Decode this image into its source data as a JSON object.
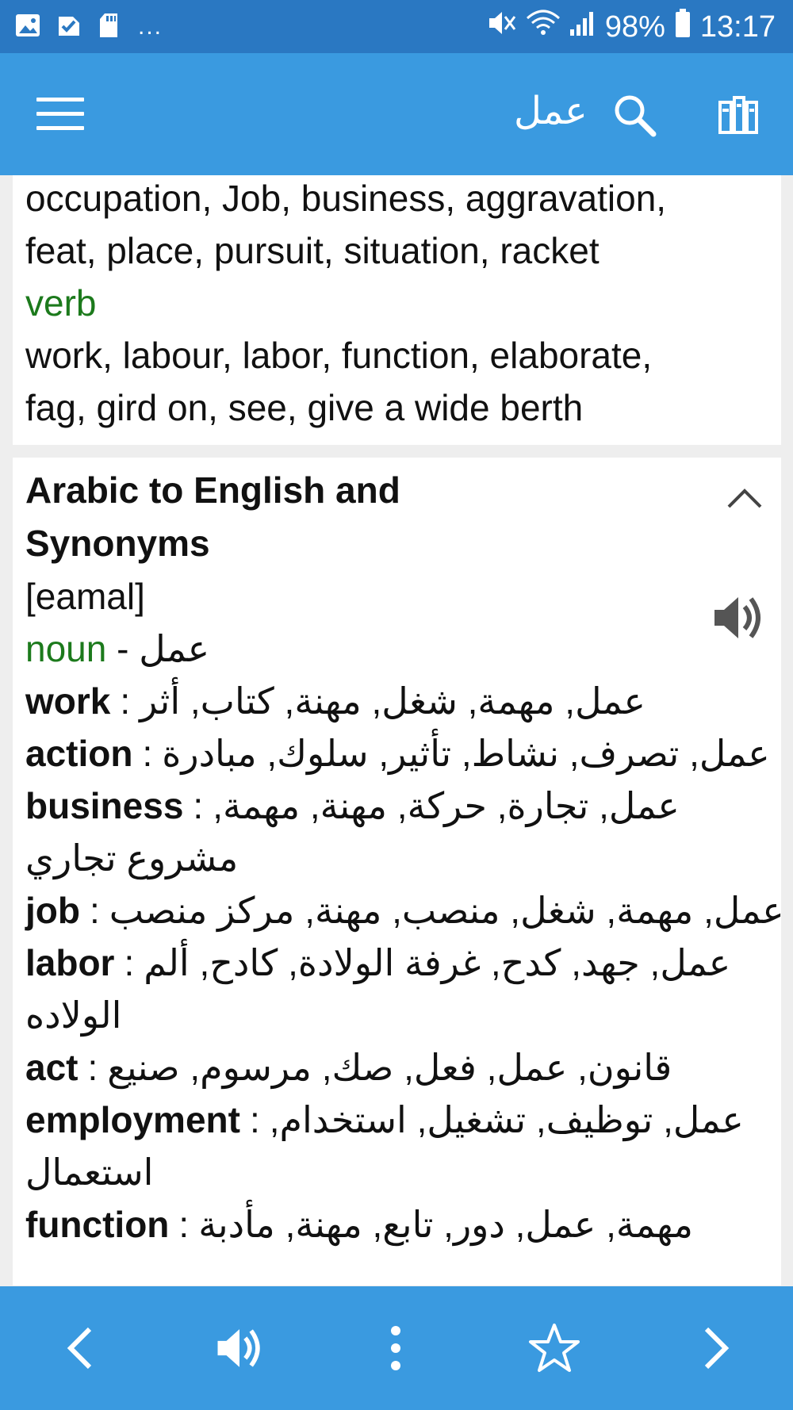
{
  "statusbar": {
    "dots": "...",
    "battery": "98%",
    "time": "13:17"
  },
  "appbar": {
    "query": "عمل"
  },
  "card1": {
    "line1": "occupation, Job, business, aggravation,",
    "line2": "feat, place, pursuit, situation, racket",
    "pos_verb": "verb",
    "line3": "work, labour, labor, function, elaborate,",
    "line4": "fag, gird on, see, give a wide berth"
  },
  "card2": {
    "title_line1": "Arabic to English and",
    "title_line2": "Synonyms",
    "pronunciation": "[eamal]",
    "pos_noun": "noun",
    "noun_sep": " - ",
    "noun_word": "عمل",
    "entries": [
      {
        "word": "work",
        "ar": "عمل, مهمة, شغل, مهنة, كتاب, أثر"
      },
      {
        "word": "action",
        "ar": "عمل, تصرف, نشاط, تأثير, سلوك, مبادرة"
      },
      {
        "word": "business",
        "ar": "عمل, تجارة, حركة, مهنة, مهمة,",
        "ar2": "مشروع تجاري"
      },
      {
        "word": "job",
        "ar": "عمل, مهمة, شغل, منصب, مهنة, مركز منصب"
      },
      {
        "word": "labor",
        "ar": "عمل, جهد, كدح, غرفة الولادة, كادح, ألم",
        "ar2": "الولاده"
      },
      {
        "word": "act",
        "ar": "قانون, عمل, فعل, صك, مرسوم, صنيع"
      },
      {
        "word": "employment",
        "ar": "عمل, توظيف, تشغيل, استخدام,",
        "ar2": "استعمال"
      },
      {
        "word": "function",
        "ar": "مهمة, عمل, دور, تابع, مهنة, مأدبة"
      }
    ],
    "colon": ":"
  },
  "colors": {
    "statusbar": "#2a78c2",
    "appbar": "#3a9ae0",
    "pos_green": "#1c7a1c"
  },
  "icons": [
    "image-icon",
    "task-icon",
    "sd-card-icon",
    "mute-icon",
    "wifi-icon",
    "signal-icon",
    "battery-icon",
    "menu-icon",
    "search-icon",
    "books-icon",
    "chevron-up-icon",
    "speaker-icon",
    "chevron-left-icon",
    "more-vert-icon",
    "star-icon",
    "chevron-right-icon"
  ]
}
